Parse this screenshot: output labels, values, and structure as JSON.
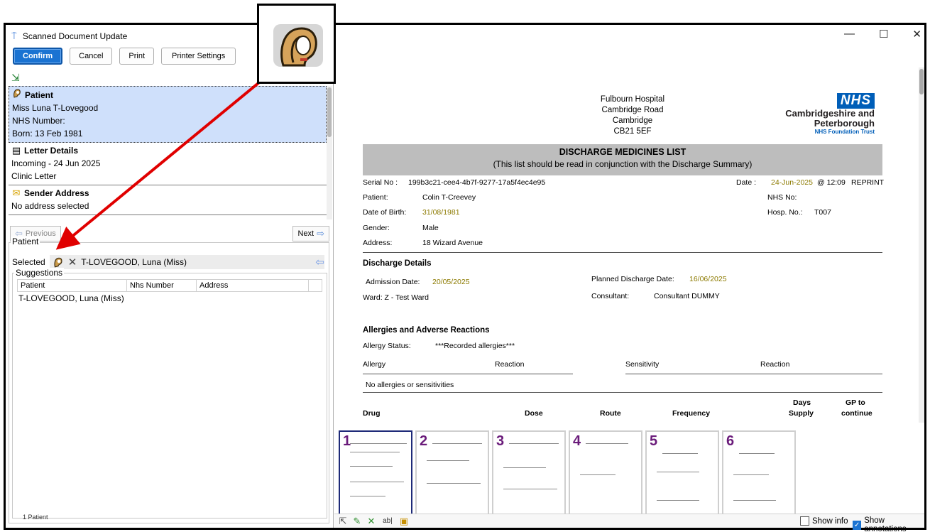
{
  "window": {
    "title": "Scanned Document Update",
    "controls": [
      "—",
      "☐",
      "✕"
    ]
  },
  "toolbar": {
    "confirm": "Confirm",
    "cancel": "Cancel",
    "print": "Print",
    "printer_settings": "Printer Settings"
  },
  "sections": {
    "patient": {
      "heading": "Patient",
      "name": "Miss Luna T-Lovegood",
      "nhs": "NHS Number:",
      "born": "Born: 13 Feb 1981"
    },
    "letter": {
      "heading": "Letter Details",
      "line1": "Incoming - 24 Jun 2025",
      "line2": "Clinic Letter"
    },
    "sender": {
      "heading": "Sender Address",
      "line1": "No address selected"
    }
  },
  "nav": {
    "previous": "Previous",
    "next": "Next"
  },
  "patient_group": {
    "legend": "Patient",
    "selected_label": "Selected",
    "selected_value": "T-LOVEGOOD, Luna (Miss)",
    "suggestions_legend": "Suggestions",
    "columns": [
      "Patient",
      "Nhs Number",
      "Address"
    ],
    "rows": [
      "T-LOVEGOOD, Luna (Miss)"
    ],
    "count": "1 Patient"
  },
  "document": {
    "hospital": [
      "Fulbourn Hospital",
      "Cambridge Road",
      "Cambridge",
      "CB21 5EF"
    ],
    "nhs_logo": "NHS",
    "nhs_org": [
      "Cambridgeshire and",
      "Peterborough"
    ],
    "nhs_trust": "NHS Foundation Trust",
    "banner_title": "DISCHARGE MEDICINES LIST",
    "banner_sub": "(This list should be read in conjunction with the Discharge Summary)",
    "serial_label": "Serial No :",
    "serial_value": "199b3c21-cee4-4b7f-9277-17a5f4ec4e95",
    "date_label": "Date :",
    "date_value": "24-Jun-2025",
    "time_value": "@  12:09",
    "reprint": "REPRINT",
    "patient_label": "Patient:",
    "patient_value": "Colin T-Creevey",
    "nhsno_label": "NHS No:",
    "dob_label": "Date of Birth:",
    "dob_value": "31/08/1981",
    "hosp_label": "Hosp. No.:",
    "hosp_value": "T007",
    "gender_label": "Gender:",
    "gender_value": "Male",
    "address_label": "Address:",
    "address_value": "18 Wizard Avenue",
    "discharge_heading": "Discharge Details",
    "admission_label": "Admission Date:",
    "admission_value": "20/05/2025",
    "planned_label": "Planned Discharge Date:",
    "planned_value": "16/06/2025",
    "ward": "Ward:   Z - Test Ward",
    "consultant_label": "Consultant:",
    "consultant_value": "Consultant DUMMY",
    "allergy_heading": "Allergies and Adverse Reactions",
    "allergy_status_label": "Allergy Status:",
    "allergy_status_value": "***Recorded allergies***",
    "col_allergy": "Allergy",
    "col_reaction": "Reaction",
    "col_sensitivity": "Sensitivity",
    "col_reaction2": "Reaction",
    "no_allergies": "No allergies or sensitivities",
    "drug": "Drug",
    "dose": "Dose",
    "route": "Route",
    "frequency": "Frequency",
    "days": "Days",
    "supply": "Supply",
    "gp_to": "GP to",
    "continue": "continue"
  },
  "thumbnails": [
    "1",
    "2",
    "3",
    "4",
    "5",
    "6"
  ],
  "status": {
    "show_info": "Show info",
    "show_annotations": "Show annotations",
    "text_tool": "ab|"
  },
  "colors": {
    "accent": "#1a73d2",
    "nhs_blue": "#005eb8",
    "arrow_red": "#e00000",
    "page_num": "#6a1b7a"
  }
}
